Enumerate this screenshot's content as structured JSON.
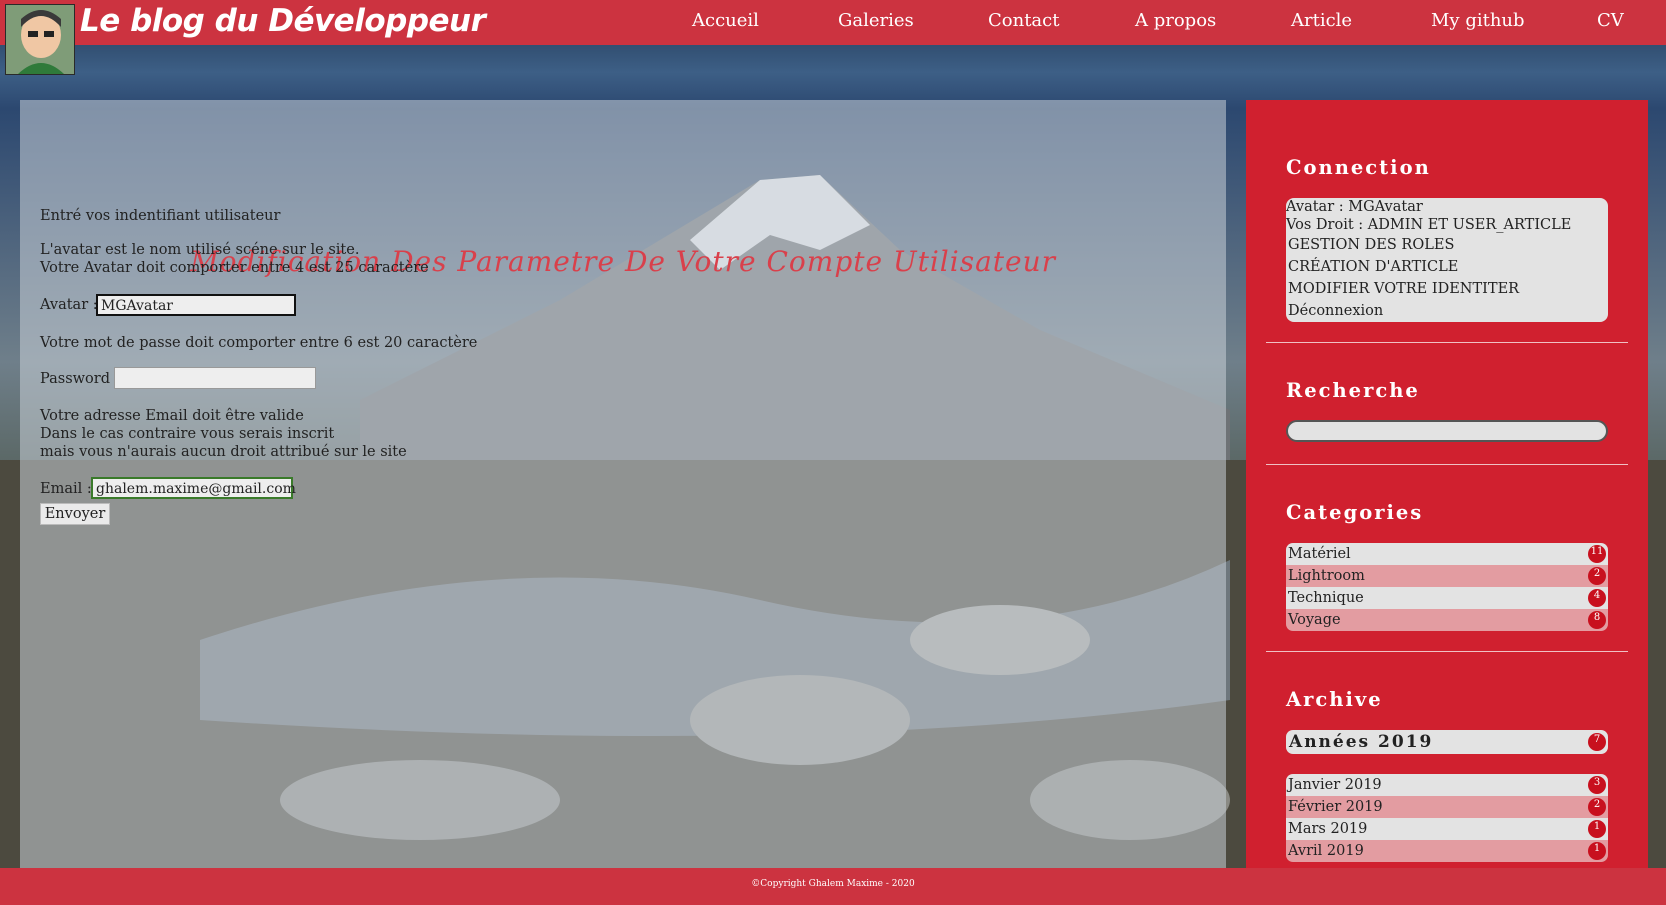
{
  "header": {
    "site_title": "Le blog du Développeur",
    "nav": [
      "Accueil",
      "Galeries",
      "Contact",
      "A propos",
      "Article",
      "My github",
      "CV"
    ]
  },
  "main": {
    "title": "Modification Des Parametre De Votre Compte Utilisateur",
    "intro": "Entré vos indentifiant utilisateur",
    "avatar_help_1": "L'avatar est le nom utilisé scéne sur le site.",
    "avatar_help_2": "Votre Avatar doit comporter entre 4 est 25 caractère",
    "avatar_label": "Avatar :",
    "avatar_value": "MGAvatar",
    "password_help": "Votre mot de passe doit comporter entre 6 est 20 caractère",
    "password_label": "Password :",
    "password_value": "",
    "email_help_1": "Votre adresse Email doit être valide",
    "email_help_2": "Dans le cas contraire vous serais inscrit",
    "email_help_3": "mais vous n'aurais aucun droit attribué sur le site",
    "email_label": "Email :",
    "email_value": "ghalem.maxime@gmail.com",
    "submit_label": "Envoyer"
  },
  "sidebar": {
    "connection": {
      "heading": "Connection",
      "avatar_line": "Avatar : MGAvatar",
      "rights_line": "Vos Droit : ADMIN ET USER_ARTICLE",
      "links": [
        "GESTION DES ROLES",
        "CRÉATION D'ARTICLE",
        "MODIFIER VOTRE IDENTITER",
        "Déconnexion"
      ]
    },
    "search": {
      "heading": "Recherche",
      "value": ""
    },
    "categories": {
      "heading": "Categories",
      "items": [
        {
          "label": "Matériel",
          "count": "11"
        },
        {
          "label": "Lightroom",
          "count": "2"
        },
        {
          "label": "Technique",
          "count": "4"
        },
        {
          "label": "Voyage",
          "count": "8"
        }
      ]
    },
    "archive": {
      "heading": "Archive",
      "year_label": "Années 2019",
      "year_count": "7",
      "months": [
        {
          "label": "Janvier 2019",
          "count": "3"
        },
        {
          "label": "Février 2019",
          "count": "2"
        },
        {
          "label": "Mars 2019",
          "count": "1"
        },
        {
          "label": "Avril 2019",
          "count": "1"
        }
      ]
    }
  },
  "footer": {
    "text": "©Copyright Ghalem Maxime - 2020"
  },
  "colors": {
    "brand_red": "#cc3340",
    "sidebar_red": "#d0202f",
    "title_red": "#d9404b"
  }
}
